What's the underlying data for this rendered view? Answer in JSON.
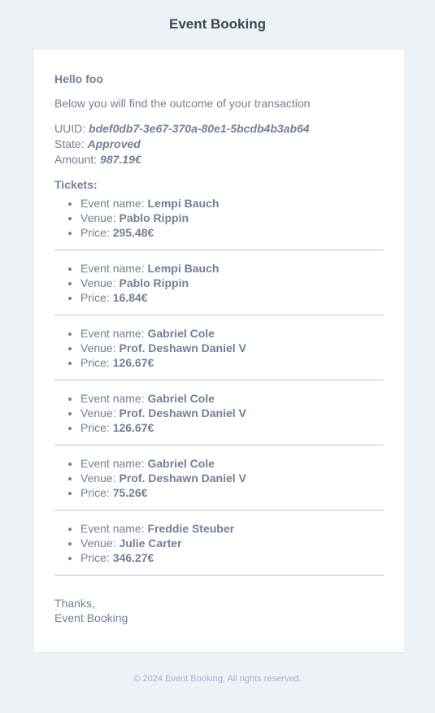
{
  "header": {
    "title": "Event Booking"
  },
  "email": {
    "greeting": "Hello foo",
    "intro": "Below you will find the outcome of your transaction",
    "uuid_label": "UUID:",
    "uuid_value": "bdef0db7-3e67-370a-80e1-5bcdb4b3ab64",
    "state_label": "State:",
    "state_value": "Approved",
    "amount_label": "Amount:",
    "amount_value": "987.19€",
    "tickets_title": "Tickets:",
    "event_label": "Event name:",
    "venue_label": "Venue:",
    "price_label": "Price:",
    "tickets": [
      {
        "event": "Lempi Bauch",
        "venue": "Pablo Rippin",
        "price": "295.48€"
      },
      {
        "event": "Lempi Bauch",
        "venue": "Pablo Rippin",
        "price": "16.84€"
      },
      {
        "event": "Gabriel Cole",
        "venue": "Prof. Deshawn Daniel V",
        "price": "126.67€"
      },
      {
        "event": "Gabriel Cole",
        "venue": "Prof. Deshawn Daniel V",
        "price": "126.67€"
      },
      {
        "event": "Gabriel Cole",
        "venue": "Prof. Deshawn Daniel V",
        "price": "75.26€"
      },
      {
        "event": "Freddie Steuber",
        "venue": "Julie Carter",
        "price": "346.27€"
      }
    ],
    "thanks": "Thanks,",
    "signature": "Event Booking"
  },
  "footer": {
    "text": "© 2024 Event Booking. All rights reserved."
  },
  "colors": {
    "background": "#edf2f7",
    "card": "#ffffff",
    "text": "#718096",
    "heading": "#3d4852"
  }
}
